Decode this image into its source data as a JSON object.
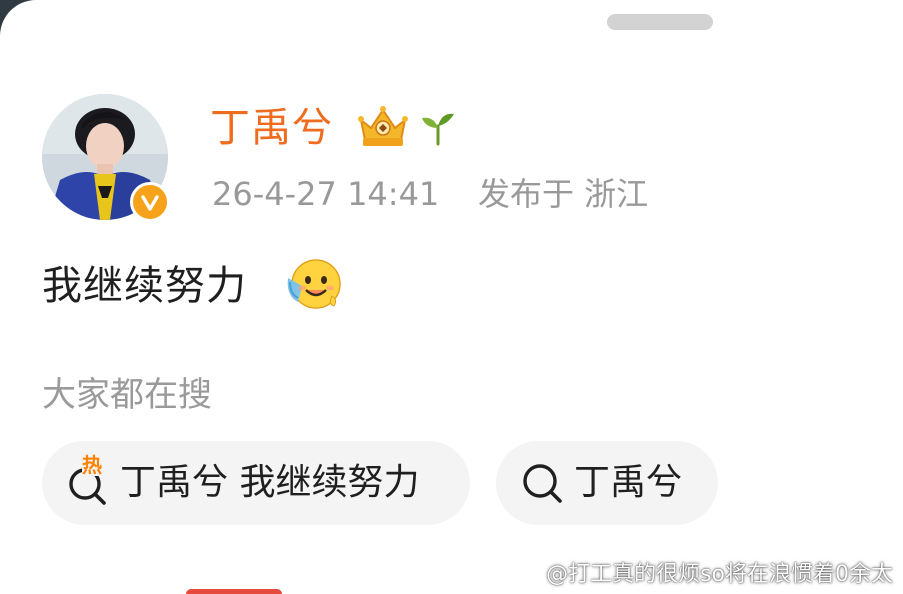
{
  "post": {
    "author": "丁禹兮",
    "time": "26-4-27 14:41",
    "location": "发布于 浙江",
    "text": "我继续努力"
  },
  "badges": {
    "verified_icon": "verified-v-icon",
    "crown_icon": "crown-badge-icon",
    "sprout_icon": "sprout-icon",
    "emoji_icon": "sweat-smile-emoji"
  },
  "search": {
    "section_label": "大家都在搜",
    "hot_tag": "热",
    "suggestions": [
      {
        "label": "丁禹兮 我继续努力",
        "icon": "hot-search-icon"
      },
      {
        "label": "丁禹兮",
        "icon": "search-icon"
      }
    ]
  },
  "watermark": {
    "text": "@打工真的很烦so将在浪惯着0余太"
  },
  "colors": {
    "author": "#ef6b1e",
    "meta": "#999999",
    "pill_bg": "#f4f4f4",
    "verified": "#f6a21a",
    "hot": "#ff8200"
  }
}
